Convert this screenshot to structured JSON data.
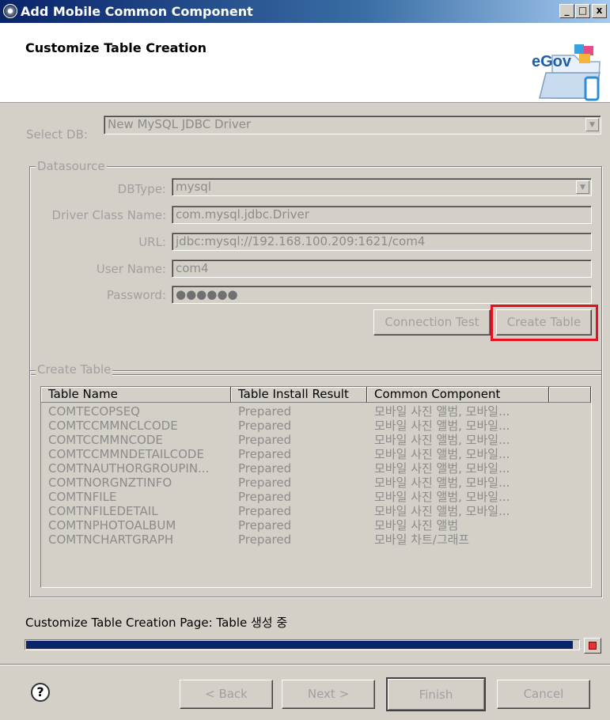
{
  "window": {
    "title": "Add Mobile Common Component",
    "controls": [
      "_",
      "□",
      "x"
    ]
  },
  "header": {
    "title": "Customize Table Creation",
    "logo_text": "eGov"
  },
  "select_db": {
    "label": "Select DB:",
    "value": "New MySQL JDBC Driver"
  },
  "datasource": {
    "legend": "Datasource",
    "dbtype_label": "DBType:",
    "dbtype_value": "mysql",
    "driver_label": "Driver Class Name:",
    "driver_value": "com.mysql.jdbc.Driver",
    "url_label": "URL:",
    "url_value": "jdbc:mysql://192.168.100.209:1621/com4",
    "user_label": "User Name:",
    "user_value": "com4",
    "password_label": "Password:",
    "password_value": "●●●●●●",
    "connection_test": "Connection Test",
    "create_table": "Create Table"
  },
  "create_table": {
    "legend": "Create Table",
    "columns": [
      "Table Name",
      "Table Install Result",
      "Common Component"
    ],
    "rows": [
      {
        "name": "COMTECOPSEQ",
        "result": "Prepared",
        "component": "모바일 사진 앨범, 모바일..."
      },
      {
        "name": "COMTCCMMNCLCODE",
        "result": "Prepared",
        "component": "모바일 사진 앨범, 모바일..."
      },
      {
        "name": "COMTCCMMNCODE",
        "result": "Prepared",
        "component": "모바일 사진 앨범, 모바일..."
      },
      {
        "name": "COMTCCMMNDETAILCODE",
        "result": "Prepared",
        "component": "모바일 사진 앨범, 모바일..."
      },
      {
        "name": "COMTNAUTHORGROUPIN...",
        "result": "Prepared",
        "component": "모바일 사진 앨범, 모바일..."
      },
      {
        "name": "COMTNORGNZTINFO",
        "result": "Prepared",
        "component": "모바일 사진 앨범, 모바일..."
      },
      {
        "name": "COMTNFILE",
        "result": "Prepared",
        "component": "모바일 사진 앨범, 모바일..."
      },
      {
        "name": "COMTNFILEDETAIL",
        "result": "Prepared",
        "component": "모바일 사진 앨범, 모바일..."
      },
      {
        "name": "COMTNPHOTOALBUM",
        "result": "Prepared",
        "component": "모바일 사진 앨범"
      },
      {
        "name": "COMTNCHARTGRAPH",
        "result": "Prepared",
        "component": "모바일 차트/그래프"
      }
    ]
  },
  "status": {
    "text": "Customize Table Creation Page: Table 생성 중",
    "progress": 0.99
  },
  "footer": {
    "help": "?",
    "back": "< Back",
    "next": "Next >",
    "finish": "Finish",
    "cancel": "Cancel"
  },
  "colors": {
    "highlight": "#e8101e",
    "progress": "#0a246a"
  }
}
